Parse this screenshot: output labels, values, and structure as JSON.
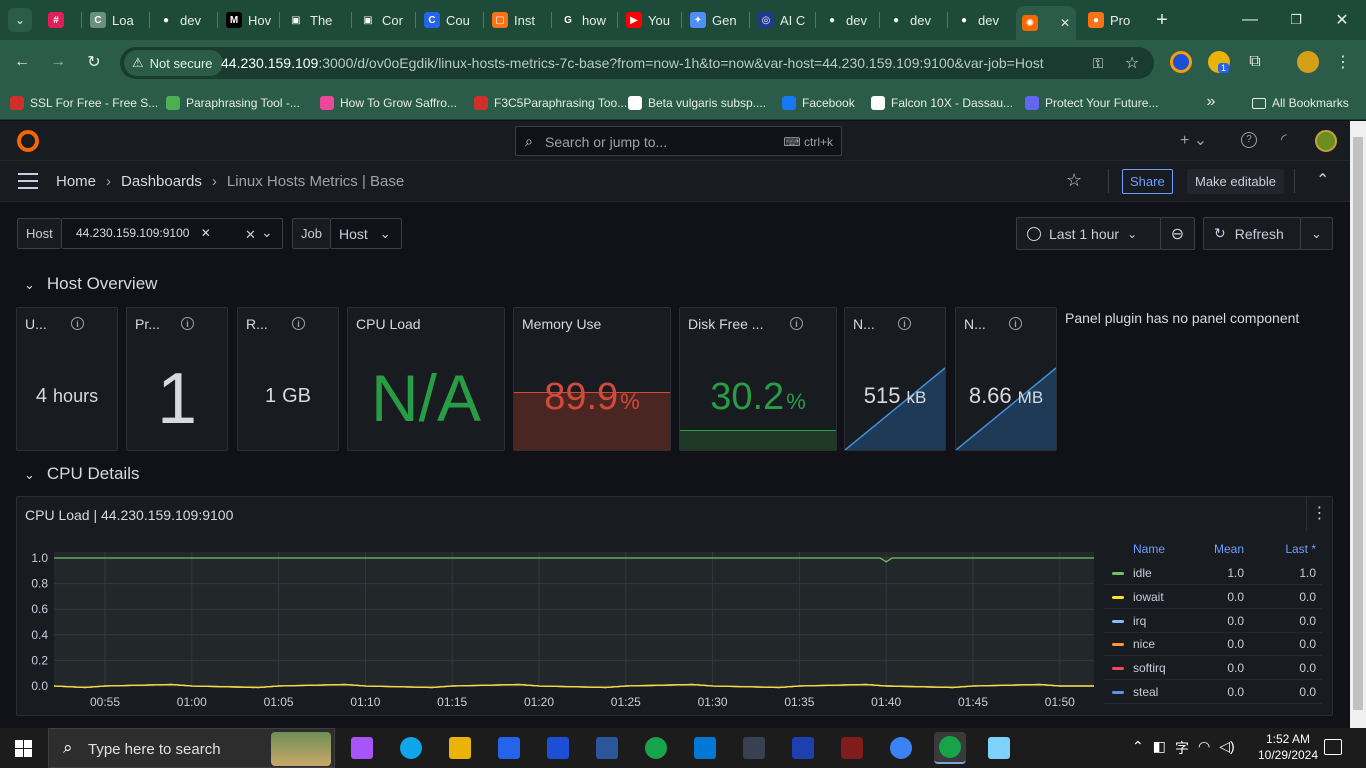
{
  "browser": {
    "tabs": [
      {
        "label": "",
        "color": "#e01e5a",
        "glyph": "#"
      },
      {
        "label": "Loa",
        "color": "#6b8f80",
        "glyph": "C"
      },
      {
        "label": "dev",
        "color": "#ffffff",
        "glyph": "●"
      },
      {
        "label": "Hov",
        "color": "#000000",
        "glyph": "M"
      },
      {
        "label": "The",
        "color": "#ffffff",
        "glyph": "▣"
      },
      {
        "label": "Cor",
        "color": "#ffffff",
        "glyph": "▣"
      },
      {
        "label": "Cou",
        "color": "#2563eb",
        "glyph": "C"
      },
      {
        "label": "Inst",
        "color": "#f97316",
        "glyph": "▢"
      },
      {
        "label": "how",
        "color": "#ffffff",
        "glyph": "G"
      },
      {
        "label": "You",
        "color": "#ff0000",
        "glyph": "▶"
      },
      {
        "label": "Gen",
        "color": "#4f8ef7",
        "glyph": "✦"
      },
      {
        "label": "AI C",
        "color": "#1e3a8a",
        "glyph": "◎"
      },
      {
        "label": "dev",
        "color": "#ffffff",
        "glyph": "●"
      },
      {
        "label": "dev",
        "color": "#ffffff",
        "glyph": "●"
      },
      {
        "label": "dev",
        "color": "#ffffff",
        "glyph": "●"
      },
      {
        "label": "",
        "color": "#f46800",
        "glyph": "✺",
        "active": true
      },
      {
        "label": "Pro",
        "color": "#f97316",
        "glyph": "●"
      }
    ],
    "not_secure": "Not secure",
    "url_host": "44.230.159.109",
    "url_rest": ":3000/d/ov0oEgdik/linux-hosts-metrics-7c-base?from=now-1h&to=now&var-host=44.230.159.109:9100&var-job=Host",
    "extension_badge": "1",
    "bookmarks": [
      {
        "label": "SSL For Free - Free S...",
        "color": "#d0302a"
      },
      {
        "label": "Paraphrasing Tool -...",
        "color": "#4caf50"
      },
      {
        "label": "How To Grow Saffro...",
        "color": "#ec4899"
      },
      {
        "label": "\u0001F3C5Paraphrasing Too...",
        "color": "#d0302a"
      },
      {
        "label": "Beta vulgaris subsp....",
        "color": "#ffffff"
      },
      {
        "label": "Facebook",
        "color": "#1877f2"
      },
      {
        "label": "Falcon 10X - Dassau...",
        "color": "#ffffff"
      },
      {
        "label": "Protect Your Future...",
        "color": "#6366f1"
      }
    ],
    "all_bookmarks": "All Bookmarks"
  },
  "grafana": {
    "search_placeholder": "Search or jump to...",
    "search_shortcut": "ctrl+k",
    "breadcrumb": [
      "Home",
      "Dashboards",
      "Linux Hosts Metrics | Base"
    ],
    "share_label": "Share",
    "make_editable_label": "Make editable",
    "vars": {
      "host_label": "Host",
      "host_value": "44.230.159.109:9100",
      "job_label": "Job",
      "job_value": "Host"
    },
    "time_range": "Last 1 hour",
    "refresh_label": "Refresh",
    "rows": {
      "overview": "Host Overview",
      "cpu": "CPU Details"
    },
    "stats": [
      {
        "title": "U...",
        "value": "4",
        "unit": "hours",
        "color": "#d8d9df"
      },
      {
        "title": "Pr...",
        "value": "1",
        "unit": "",
        "color": "#d8d9df"
      },
      {
        "title": "R...",
        "value": "1",
        "unit": "GB",
        "color": "#d8d9df"
      },
      {
        "title": "CPU Load",
        "value": "N/A",
        "unit": "",
        "color": "#299c46"
      },
      {
        "title": "Memory Use",
        "value": "89.9",
        "unit": "%",
        "color": "#d44a3a"
      },
      {
        "title": "Disk Free ...",
        "value": "30.2",
        "unit": "%",
        "color": "#299c46"
      },
      {
        "title": "N...",
        "value": "515",
        "unit": "kB",
        "color": "#d8d9df"
      },
      {
        "title": "N...",
        "value": "8.66",
        "unit": "MB",
        "color": "#d8d9df"
      }
    ],
    "plugin_message": "Panel plugin has no panel component",
    "cpu_panel_title": "CPU Load | 44.230.159.109:9100",
    "legend": {
      "headers": [
        "Name",
        "Mean",
        "Last *"
      ],
      "rows": [
        {
          "name": "idle",
          "mean": "1.0",
          "last": "1.0",
          "color": "#73bf69"
        },
        {
          "name": "iowait",
          "mean": "0.0",
          "last": "0.0",
          "color": "#fade2a"
        },
        {
          "name": "irq",
          "mean": "0.0",
          "last": "0.0",
          "color": "#8ab8ff"
        },
        {
          "name": "nice",
          "mean": "0.0",
          "last": "0.0",
          "color": "#ff9830"
        },
        {
          "name": "softirq",
          "mean": "0.0",
          "last": "0.0",
          "color": "#f2495c"
        },
        {
          "name": "steal",
          "mean": "0.0",
          "last": "0.0",
          "color": "#5794f2"
        }
      ]
    }
  },
  "chart_data": {
    "type": "line",
    "title": "CPU Load | 44.230.159.109:9100",
    "x_ticks": [
      "00:55",
      "01:00",
      "01:05",
      "01:10",
      "01:15",
      "01:20",
      "01:25",
      "01:30",
      "01:35",
      "01:40",
      "01:45",
      "01:50"
    ],
    "y_ticks": [
      "0.0",
      "0.2",
      "0.4",
      "0.6",
      "0.8",
      "1.0"
    ],
    "ylim": [
      0,
      1.0
    ],
    "grid": true,
    "legend_placement": "right",
    "series": [
      {
        "name": "idle",
        "color": "#73bf69",
        "values": [
          1.0,
          1.0,
          1.0,
          1.0,
          1.0,
          1.0,
          1.0,
          1.0,
          1.0,
          0.97,
          1.0,
          1.0
        ]
      },
      {
        "name": "iowait",
        "color": "#fade2a",
        "values": [
          0,
          0,
          0,
          0,
          0,
          0,
          0,
          0,
          0,
          0,
          0,
          0
        ]
      },
      {
        "name": "irq",
        "color": "#8ab8ff",
        "values": [
          0,
          0,
          0,
          0,
          0,
          0,
          0,
          0,
          0,
          0,
          0,
          0
        ]
      },
      {
        "name": "nice",
        "color": "#ff9830",
        "values": [
          0,
          0,
          0,
          0,
          0,
          0,
          0,
          0,
          0,
          0,
          0,
          0
        ]
      },
      {
        "name": "softirq",
        "color": "#f2495c",
        "values": [
          0,
          0,
          0,
          0,
          0,
          0,
          0,
          0,
          0,
          0,
          0,
          0
        ]
      },
      {
        "name": "steal",
        "color": "#5794f2",
        "values": [
          0,
          0,
          0,
          0,
          0,
          0,
          0,
          0,
          0,
          0,
          0,
          0
        ]
      }
    ]
  },
  "taskbar": {
    "search_placeholder": "Type here to search",
    "time": "1:52 AM",
    "date": "10/29/2024"
  }
}
